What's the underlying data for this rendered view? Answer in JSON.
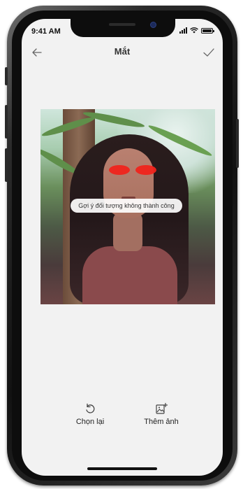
{
  "status_bar": {
    "time": "9:41 AM"
  },
  "header": {
    "title": "Mắt"
  },
  "photo": {
    "toast": "Gợi ý đối tượng không thành công"
  },
  "actions": [
    {
      "label": "Chọn lại"
    },
    {
      "label": "Thêm ảnh"
    }
  ],
  "colors": {
    "eye_mask": "#f0241c",
    "screen_bg": "#f2f2f2"
  }
}
